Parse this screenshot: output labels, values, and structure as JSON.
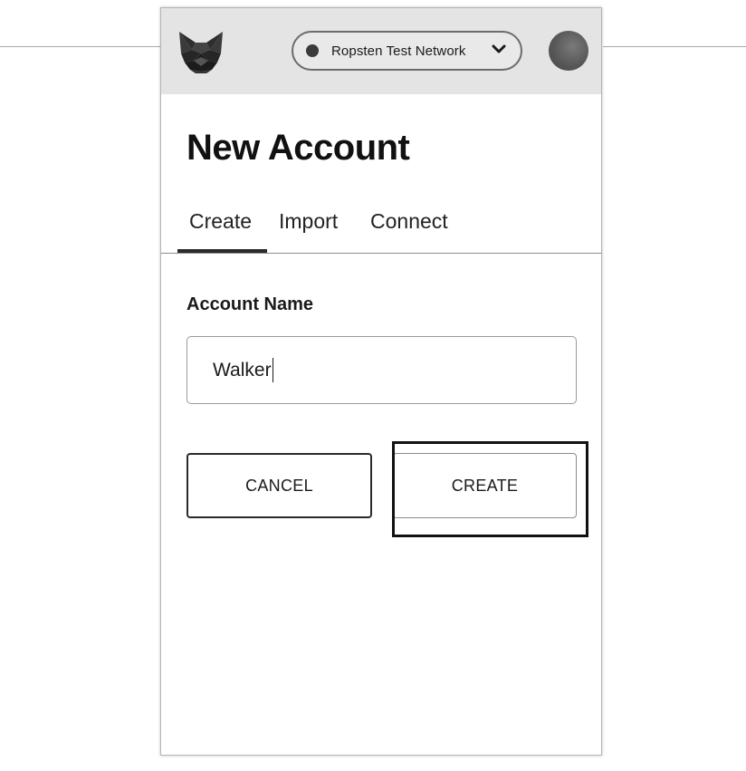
{
  "header": {
    "logo": "metamask-fox-icon",
    "network": {
      "label": "Ropsten Test Network",
      "status_icon": "network-status-dot",
      "dropdown_icon": "chevron-down-icon"
    },
    "account_avatar": "account-avatar"
  },
  "main": {
    "title": "New Account",
    "tabs": [
      {
        "label": "Create",
        "active": true
      },
      {
        "label": "Import",
        "active": false
      },
      {
        "label": "Connect",
        "active": false
      }
    ],
    "form": {
      "field_label": "Account Name",
      "field_value": "Walker"
    },
    "actions": {
      "cancel_label": "CANCEL",
      "create_label": "CREATE"
    }
  }
}
